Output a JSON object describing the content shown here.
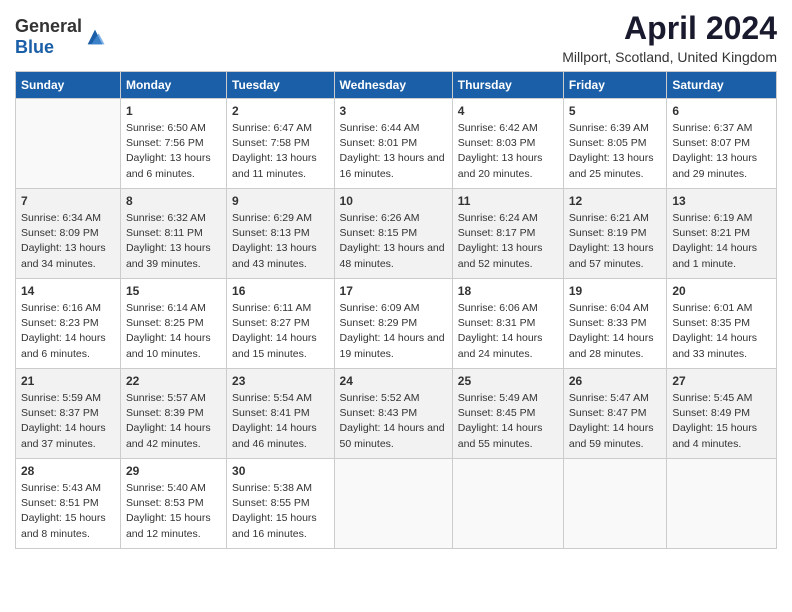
{
  "header": {
    "logo_general": "General",
    "logo_blue": "Blue",
    "title": "April 2024",
    "subtitle": "Millport, Scotland, United Kingdom"
  },
  "days_of_week": [
    "Sunday",
    "Monday",
    "Tuesday",
    "Wednesday",
    "Thursday",
    "Friday",
    "Saturday"
  ],
  "weeks": [
    [
      {
        "day": "",
        "sunrise": "",
        "sunset": "",
        "daylight": ""
      },
      {
        "day": "1",
        "sunrise": "Sunrise: 6:50 AM",
        "sunset": "Sunset: 7:56 PM",
        "daylight": "Daylight: 13 hours and 6 minutes."
      },
      {
        "day": "2",
        "sunrise": "Sunrise: 6:47 AM",
        "sunset": "Sunset: 7:58 PM",
        "daylight": "Daylight: 13 hours and 11 minutes."
      },
      {
        "day": "3",
        "sunrise": "Sunrise: 6:44 AM",
        "sunset": "Sunset: 8:01 PM",
        "daylight": "Daylight: 13 hours and 16 minutes."
      },
      {
        "day": "4",
        "sunrise": "Sunrise: 6:42 AM",
        "sunset": "Sunset: 8:03 PM",
        "daylight": "Daylight: 13 hours and 20 minutes."
      },
      {
        "day": "5",
        "sunrise": "Sunrise: 6:39 AM",
        "sunset": "Sunset: 8:05 PM",
        "daylight": "Daylight: 13 hours and 25 minutes."
      },
      {
        "day": "6",
        "sunrise": "Sunrise: 6:37 AM",
        "sunset": "Sunset: 8:07 PM",
        "daylight": "Daylight: 13 hours and 29 minutes."
      }
    ],
    [
      {
        "day": "7",
        "sunrise": "Sunrise: 6:34 AM",
        "sunset": "Sunset: 8:09 PM",
        "daylight": "Daylight: 13 hours and 34 minutes."
      },
      {
        "day": "8",
        "sunrise": "Sunrise: 6:32 AM",
        "sunset": "Sunset: 8:11 PM",
        "daylight": "Daylight: 13 hours and 39 minutes."
      },
      {
        "day": "9",
        "sunrise": "Sunrise: 6:29 AM",
        "sunset": "Sunset: 8:13 PM",
        "daylight": "Daylight: 13 hours and 43 minutes."
      },
      {
        "day": "10",
        "sunrise": "Sunrise: 6:26 AM",
        "sunset": "Sunset: 8:15 PM",
        "daylight": "Daylight: 13 hours and 48 minutes."
      },
      {
        "day": "11",
        "sunrise": "Sunrise: 6:24 AM",
        "sunset": "Sunset: 8:17 PM",
        "daylight": "Daylight: 13 hours and 52 minutes."
      },
      {
        "day": "12",
        "sunrise": "Sunrise: 6:21 AM",
        "sunset": "Sunset: 8:19 PM",
        "daylight": "Daylight: 13 hours and 57 minutes."
      },
      {
        "day": "13",
        "sunrise": "Sunrise: 6:19 AM",
        "sunset": "Sunset: 8:21 PM",
        "daylight": "Daylight: 14 hours and 1 minute."
      }
    ],
    [
      {
        "day": "14",
        "sunrise": "Sunrise: 6:16 AM",
        "sunset": "Sunset: 8:23 PM",
        "daylight": "Daylight: 14 hours and 6 minutes."
      },
      {
        "day": "15",
        "sunrise": "Sunrise: 6:14 AM",
        "sunset": "Sunset: 8:25 PM",
        "daylight": "Daylight: 14 hours and 10 minutes."
      },
      {
        "day": "16",
        "sunrise": "Sunrise: 6:11 AM",
        "sunset": "Sunset: 8:27 PM",
        "daylight": "Daylight: 14 hours and 15 minutes."
      },
      {
        "day": "17",
        "sunrise": "Sunrise: 6:09 AM",
        "sunset": "Sunset: 8:29 PM",
        "daylight": "Daylight: 14 hours and 19 minutes."
      },
      {
        "day": "18",
        "sunrise": "Sunrise: 6:06 AM",
        "sunset": "Sunset: 8:31 PM",
        "daylight": "Daylight: 14 hours and 24 minutes."
      },
      {
        "day": "19",
        "sunrise": "Sunrise: 6:04 AM",
        "sunset": "Sunset: 8:33 PM",
        "daylight": "Daylight: 14 hours and 28 minutes."
      },
      {
        "day": "20",
        "sunrise": "Sunrise: 6:01 AM",
        "sunset": "Sunset: 8:35 PM",
        "daylight": "Daylight: 14 hours and 33 minutes."
      }
    ],
    [
      {
        "day": "21",
        "sunrise": "Sunrise: 5:59 AM",
        "sunset": "Sunset: 8:37 PM",
        "daylight": "Daylight: 14 hours and 37 minutes."
      },
      {
        "day": "22",
        "sunrise": "Sunrise: 5:57 AM",
        "sunset": "Sunset: 8:39 PM",
        "daylight": "Daylight: 14 hours and 42 minutes."
      },
      {
        "day": "23",
        "sunrise": "Sunrise: 5:54 AM",
        "sunset": "Sunset: 8:41 PM",
        "daylight": "Daylight: 14 hours and 46 minutes."
      },
      {
        "day": "24",
        "sunrise": "Sunrise: 5:52 AM",
        "sunset": "Sunset: 8:43 PM",
        "daylight": "Daylight: 14 hours and 50 minutes."
      },
      {
        "day": "25",
        "sunrise": "Sunrise: 5:49 AM",
        "sunset": "Sunset: 8:45 PM",
        "daylight": "Daylight: 14 hours and 55 minutes."
      },
      {
        "day": "26",
        "sunrise": "Sunrise: 5:47 AM",
        "sunset": "Sunset: 8:47 PM",
        "daylight": "Daylight: 14 hours and 59 minutes."
      },
      {
        "day": "27",
        "sunrise": "Sunrise: 5:45 AM",
        "sunset": "Sunset: 8:49 PM",
        "daylight": "Daylight: 15 hours and 4 minutes."
      }
    ],
    [
      {
        "day": "28",
        "sunrise": "Sunrise: 5:43 AM",
        "sunset": "Sunset: 8:51 PM",
        "daylight": "Daylight: 15 hours and 8 minutes."
      },
      {
        "day": "29",
        "sunrise": "Sunrise: 5:40 AM",
        "sunset": "Sunset: 8:53 PM",
        "daylight": "Daylight: 15 hours and 12 minutes."
      },
      {
        "day": "30",
        "sunrise": "Sunrise: 5:38 AM",
        "sunset": "Sunset: 8:55 PM",
        "daylight": "Daylight: 15 hours and 16 minutes."
      },
      {
        "day": "",
        "sunrise": "",
        "sunset": "",
        "daylight": ""
      },
      {
        "day": "",
        "sunrise": "",
        "sunset": "",
        "daylight": ""
      },
      {
        "day": "",
        "sunrise": "",
        "sunset": "",
        "daylight": ""
      },
      {
        "day": "",
        "sunrise": "",
        "sunset": "",
        "daylight": ""
      }
    ]
  ]
}
